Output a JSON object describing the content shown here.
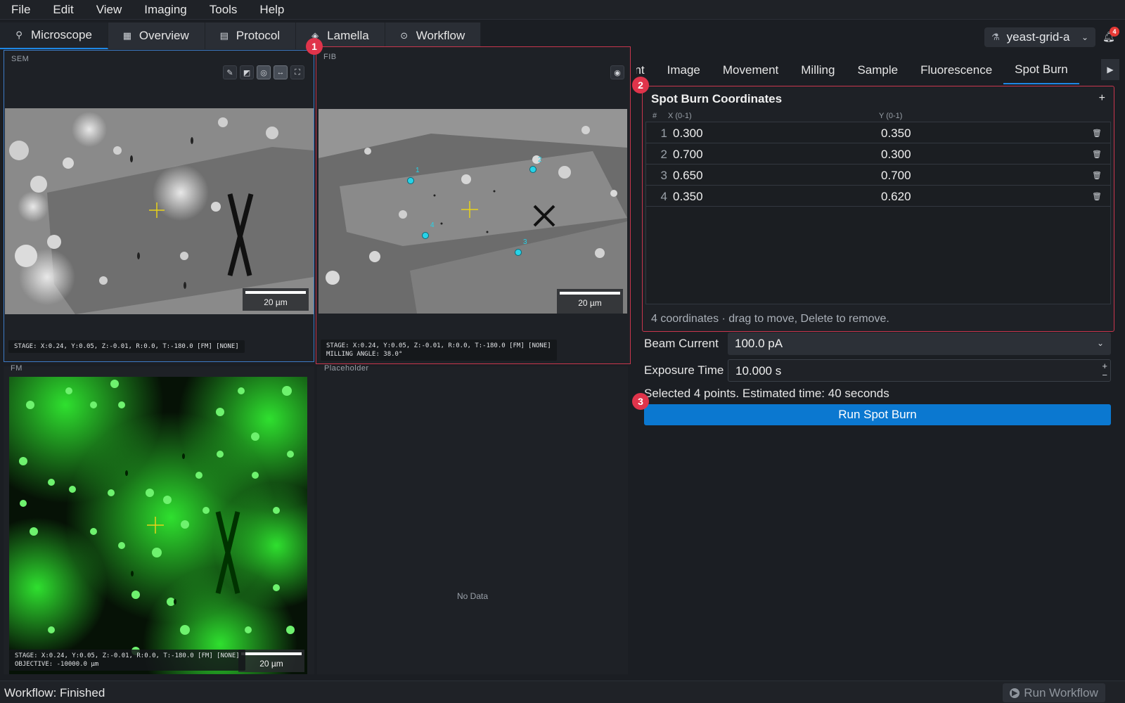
{
  "menu": [
    "File",
    "Edit",
    "View",
    "Imaging",
    "Tools",
    "Help"
  ],
  "tabs": [
    {
      "label": "Microscope",
      "icon": "microscope-icon",
      "glyph": "⚲"
    },
    {
      "label": "Overview",
      "icon": "overview-icon",
      "glyph": "▦"
    },
    {
      "label": "Protocol",
      "icon": "protocol-icon",
      "glyph": "▤"
    },
    {
      "label": "Lamella",
      "icon": "lamella-icon",
      "glyph": "◈"
    },
    {
      "label": "Workflow",
      "icon": "workflow-icon",
      "glyph": "⊙"
    }
  ],
  "project": {
    "name": "yeast-grid-a"
  },
  "notifications": {
    "count": "4"
  },
  "sem": {
    "label": "SEM",
    "stage": "STAGE: X:0.24, Y:0.05, Z:-0.01, R:0.0, T:-180.0 [FM] [NONE]",
    "scale": "20 µm"
  },
  "fib": {
    "label": "FIB",
    "stage": "STAGE: X:0.24, Y:0.05, Z:-0.01, R:0.0, T:-180.0 [FM] [NONE]",
    "milling": "MILLING ANGLE: 38.0°",
    "scale": "20 µm",
    "points": [
      "1",
      "2",
      "3",
      "4"
    ]
  },
  "fm": {
    "label": "FM",
    "stage": "STAGE: X:0.24, Y:0.05, Z:-0.01, R:0.0, T:-180.0 [FM] [NONE]",
    "objective": "OBJECTIVE: -10000.0 µm",
    "scale": "20 µm"
  },
  "placeholder": {
    "label": "Placeholder",
    "text": "No Data"
  },
  "right_tabs": [
    "ent",
    "Image",
    "Movement",
    "Milling",
    "Sample",
    "Fluorescence",
    "Spot Burn"
  ],
  "spot_burn": {
    "title": "Spot Burn Coordinates",
    "add": "+",
    "col_index": "#",
    "col_x": "X (0-1)",
    "col_y": "Y (0-1)",
    "rows": [
      {
        "i": "1",
        "x": "0.300",
        "y": "0.350"
      },
      {
        "i": "2",
        "x": "0.700",
        "y": "0.300"
      },
      {
        "i": "3",
        "x": "0.650",
        "y": "0.700"
      },
      {
        "i": "4",
        "x": "0.350",
        "y": "0.620"
      }
    ],
    "footer": "4 coordinates · drag to move, Delete to remove."
  },
  "beam_current": {
    "label": "Beam Current",
    "value": "100.0 pA"
  },
  "exposure": {
    "label": "Exposure Time",
    "value": "10.000 s"
  },
  "estimate": "Selected 4 points. Estimated time: 40 seconds",
  "run_button": "Run Spot Burn",
  "markers": [
    "1",
    "2",
    "3"
  ],
  "status": {
    "text": "Workflow: Finished",
    "run_workflow": "Run Workflow"
  },
  "colors": {
    "accent": "#0b78d0",
    "highlight": "#c9364d",
    "point": "#27d3e8",
    "crosshair": "#e8d21a"
  }
}
